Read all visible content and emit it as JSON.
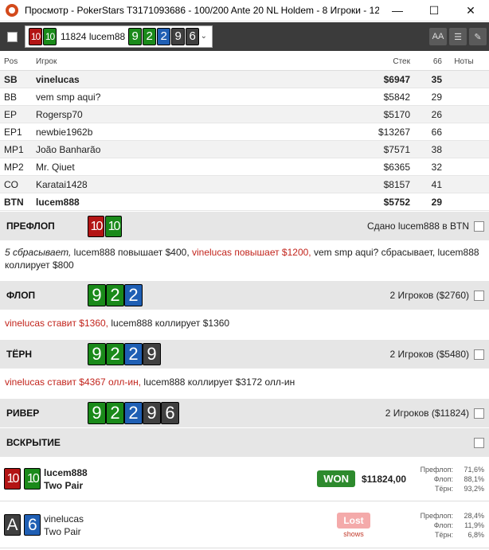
{
  "window": {
    "title": "Просмотр - PokerStars T3171093686 - 100/200 Ante 20 NL Holdem - 8 Игроки - 12...",
    "minimize": "—",
    "maximize": "☐",
    "close": "✕"
  },
  "toolbar": {
    "hand_cards": [
      {
        "rank": "10",
        "suit": "h"
      },
      {
        "rank": "10",
        "suit": "c"
      }
    ],
    "hand_label": "11824 lucem88",
    "board_cards": [
      {
        "rank": "9",
        "suit": "c"
      },
      {
        "rank": "2",
        "suit": "c"
      },
      {
        "rank": "2",
        "suit": "d"
      },
      {
        "rank": "9",
        "suit": "s"
      },
      {
        "rank": "6",
        "suit": "s"
      }
    ],
    "font_btn": "AA",
    "list_btn": "☰",
    "edit_btn": "✎"
  },
  "players": {
    "headers": {
      "pos": "Pos",
      "name": "Игрок",
      "stack": "Стек",
      "pct": "66",
      "notes": "Ноты"
    },
    "rows": [
      {
        "pos": "SB",
        "name": "vinelucas",
        "stack": "$6947",
        "pct": "35",
        "bold": true
      },
      {
        "pos": "BB",
        "name": "vem smp aqui?",
        "stack": "$5842",
        "pct": "29",
        "bold": false
      },
      {
        "pos": "EP",
        "name": "Rogersp70",
        "stack": "$5170",
        "pct": "26",
        "bold": false
      },
      {
        "pos": "EP1",
        "name": "newbie1962b",
        "stack": "$13267",
        "pct": "66",
        "bold": false
      },
      {
        "pos": "MP1",
        "name": "João Banharão",
        "stack": "$7571",
        "pct": "38",
        "bold": false
      },
      {
        "pos": "MP2",
        "name": "Mr. Qiuet",
        "stack": "$6365",
        "pct": "32",
        "bold": false
      },
      {
        "pos": "CO",
        "name": "Karatai1428",
        "stack": "$8157",
        "pct": "41",
        "bold": false
      },
      {
        "pos": "BTN",
        "name": "lucem888",
        "stack": "$5752",
        "pct": "29",
        "bold": true
      }
    ]
  },
  "preflop": {
    "name": "ПРЕФЛОП",
    "info": "Сдано lucem888 в BTN",
    "a1": "5 сбрасывает,",
    "a2": " lucem888 повышает $400,",
    "a3": " vinelucas повышает $1200,",
    "a4": " vem smp aqui? сбрасывает, lucem888 коллирует $800"
  },
  "flop": {
    "name": "ФЛОП",
    "info": "2 Игроков ($2760)",
    "a1": "vinelucas ставит $1360,",
    "a2": " lucem888 коллирует $1360"
  },
  "turn": {
    "name": "ТЁРН",
    "info": "2 Игроков ($5480)",
    "a1": "vinelucas ставит $4367 олл-ин,",
    "a2": " lucem888 коллирует $3172 олл-ин"
  },
  "river": {
    "name": "РИВЕР",
    "info": "2 Игроков ($11824)"
  },
  "showdown": {
    "name": "ВСКРЫТИЕ",
    "p1": {
      "name": "lucem888",
      "hand": "Two Pair",
      "result": "WON",
      "amount": "$11824,00",
      "eq_pre_label": "Префлоп:",
      "eq_pre": "71,6%",
      "eq_flop_label": "Флоп:",
      "eq_flop": "88,1%",
      "eq_turn_label": "Тёрн:",
      "eq_turn": "93,2%"
    },
    "p2": {
      "name": "vinelucas",
      "hand": "Two Pair",
      "result": "Lost",
      "shows": "shows",
      "eq_pre_label": "Префлоп:",
      "eq_pre": "28,4%",
      "eq_flop_label": "Флоп:",
      "eq_flop": "11,9%",
      "eq_turn_label": "Тёрн:",
      "eq_turn": "6,8%"
    }
  },
  "colors": {
    "hearts": "#b31414",
    "clubs": "#1a8a1a",
    "diamonds": "#1f5fb4",
    "spades": "#404040",
    "won": "#2d8a2d",
    "lost": "#f4aaaa",
    "action_red": "#c2241c"
  }
}
